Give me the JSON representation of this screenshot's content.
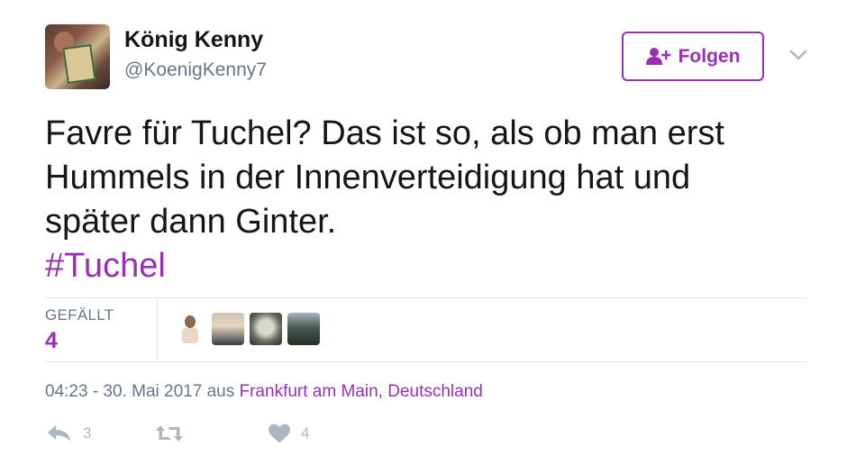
{
  "user": {
    "display_name": "König Kenny",
    "handle": "@KoenigKenny7"
  },
  "follow_button": {
    "label": "Folgen",
    "icon": "add-user-icon"
  },
  "tweet": {
    "text_line1": "Favre für Tuchel? Das ist so, als ob man erst",
    "text_line2": "Hummels in der Innenverteidigung hat und",
    "text_line3": "später dann Ginter.",
    "hashtag": "#Tuchel"
  },
  "likes": {
    "label": "GEFÄLLT",
    "count": "4",
    "likers": [
      "liker-avatar-1",
      "liker-avatar-2",
      "liker-avatar-3",
      "liker-avatar-4"
    ]
  },
  "meta": {
    "time_date": "04:23 - 30. Mai 2017",
    "from_word": "aus",
    "location": "Frankfurt am Main, Deutschland"
  },
  "actions": {
    "reply_count": "3",
    "retweet_count": "",
    "like_count": "4"
  },
  "colors": {
    "accent": "#9a2fb3",
    "secondary_text": "#657786",
    "icon_gray": "#aab8c2",
    "divider": "#e1e8ed"
  }
}
